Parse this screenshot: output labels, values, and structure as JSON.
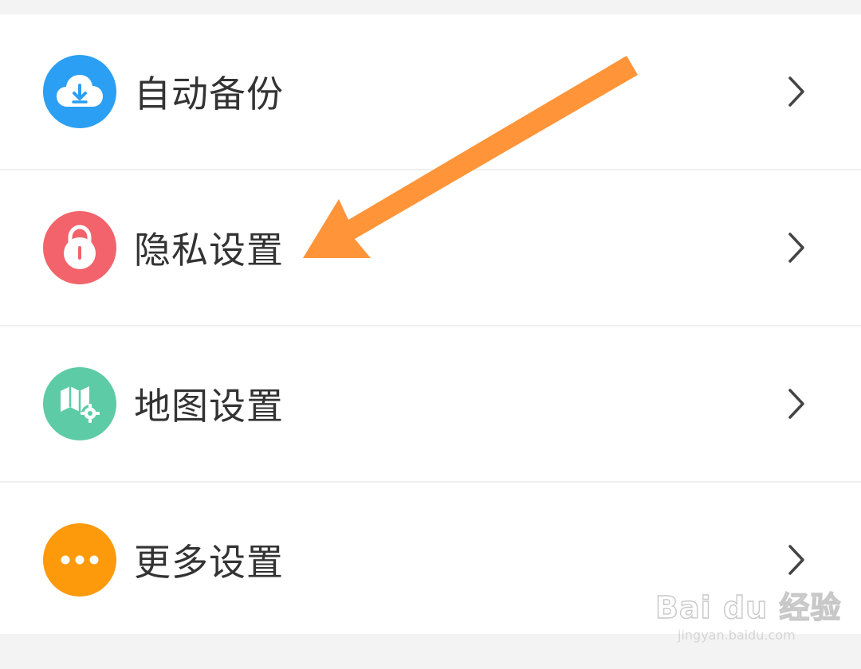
{
  "settings": {
    "items": [
      {
        "label": "自动备份",
        "icon": "cloud-download-icon",
        "color": "#2a9ff3"
      },
      {
        "label": "隐私设置",
        "icon": "lock-icon",
        "color": "#f2636b"
      },
      {
        "label": "地图设置",
        "icon": "map-gear-icon",
        "color": "#5dcca6"
      },
      {
        "label": "更多设置",
        "icon": "more-dots-icon",
        "color": "#fd9a0c"
      }
    ]
  },
  "annotation": {
    "arrow_color": "#ff9438",
    "points_to": "隐私设置"
  },
  "watermark": {
    "logo": "Bai du 经验",
    "url": "jingyan.baidu.com"
  },
  "colors": {
    "background": "#f3f3f3",
    "card": "#ffffff",
    "text": "#333333",
    "chevron": "#444444"
  }
}
